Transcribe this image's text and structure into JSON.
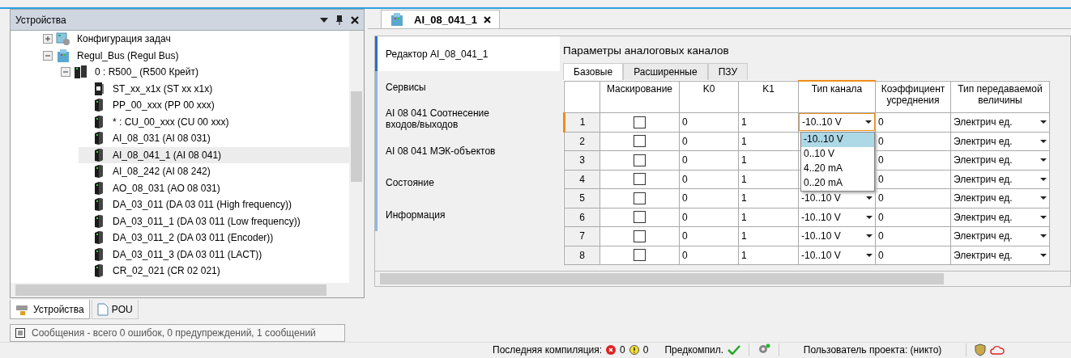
{
  "devices_panel": {
    "title": "Устройства",
    "tree": [
      {
        "label": "Конфигурация задач",
        "kind": "task-config",
        "expanded": false,
        "selected": false
      },
      {
        "label": "Regul_Bus (Regul Bus)",
        "kind": "bus",
        "expanded": true,
        "selected": false,
        "children": [
          {
            "label": "0 : R500_ (R500 Крейт)",
            "kind": "crate",
            "expanded": true,
            "selected": false,
            "children": [
              {
                "label": "ST_xx_x1x (ST xx x1x)",
                "kind": "station",
                "selected": false
              },
              {
                "label": "PP_00_xxx (PP 00 xxx)",
                "kind": "module",
                "selected": false
              },
              {
                "label": "* : CU_00_xxx (CU 00 xxx)",
                "kind": "module",
                "selected": false
              },
              {
                "label": "AI_08_031 (AI 08 031)",
                "kind": "module",
                "selected": false
              },
              {
                "label": "AI_08_041_1 (AI 08 041)",
                "kind": "module",
                "selected": true
              },
              {
                "label": "AI_08_242 (AI 08 242)",
                "kind": "module",
                "selected": false
              },
              {
                "label": "AO_08_031 (AO 08 031)",
                "kind": "module",
                "selected": false
              },
              {
                "label": "DA_03_011 (DA 03 011 (High frequency))",
                "kind": "module",
                "selected": false
              },
              {
                "label": "DA_03_011_1 (DA 03 011 (Low frequency))",
                "kind": "module",
                "selected": false
              },
              {
                "label": "DA_03_011_2 (DA 03 011 (Encoder))",
                "kind": "module",
                "selected": false
              },
              {
                "label": "DA_03_011_3 (DA 03 011 (LACT))",
                "kind": "module",
                "selected": false
              },
              {
                "label": "CR_02_021 (CR 02 021)",
                "kind": "module",
                "selected": false
              }
            ]
          }
        ]
      }
    ],
    "tabs": [
      {
        "label": "Устройства",
        "selected": true
      },
      {
        "label": "POU",
        "selected": false
      }
    ]
  },
  "messages_bar": {
    "text": "Сообщения - всего 0 ошибок, 0 предупреждений, 1 сообщений"
  },
  "editor": {
    "tab": {
      "title": "AI_08_041_1"
    },
    "nav": [
      {
        "label": "Редактор AI_08_041_1",
        "selected": true
      },
      {
        "label": "Сервисы",
        "selected": false
      },
      {
        "label": "AI 08 041 Соотнесение входов/выходов",
        "selected": false
      },
      {
        "label": "AI 08 041 МЭК-объектов",
        "selected": false
      },
      {
        "label": "Состояние",
        "selected": false
      },
      {
        "label": "Информация",
        "selected": false
      }
    ],
    "heading": "Параметры аналоговых каналов",
    "subtabs": [
      {
        "label": "Базовые",
        "selected": true
      },
      {
        "label": "Расширенные",
        "selected": false
      },
      {
        "label": "ПЗУ",
        "selected": false
      }
    ],
    "table": {
      "columns": [
        "Маскирование",
        "K0",
        "K1",
        "Тип канала",
        "Коэффициент усреднения",
        "Тип передаваемой величины"
      ],
      "rows": [
        {
          "number": "1",
          "selected": true,
          "masked": false,
          "k0": "0",
          "k1": "1",
          "channel_type": "-10..10 V",
          "averaging": "0",
          "value_type": "Электрич ед."
        },
        {
          "number": "2",
          "selected": false,
          "masked": false,
          "k0": "0",
          "k1": "1",
          "averaging": "0",
          "value_type": "Электрич ед."
        },
        {
          "number": "3",
          "selected": false,
          "masked": false,
          "k0": "0",
          "k1": "1",
          "averaging": "0",
          "value_type": "Электрич ед."
        },
        {
          "number": "4",
          "selected": false,
          "masked": false,
          "k0": "0",
          "k1": "1",
          "averaging": "0",
          "value_type": "Электрич ед."
        },
        {
          "number": "5",
          "selected": false,
          "masked": false,
          "k0": "0",
          "k1": "1",
          "channel_type": "-10..10 V",
          "averaging": "0",
          "value_type": "Электрич ед."
        },
        {
          "number": "6",
          "selected": false,
          "masked": false,
          "k0": "0",
          "k1": "1",
          "channel_type": "-10..10 V",
          "averaging": "0",
          "value_type": "Электрич ед."
        },
        {
          "number": "7",
          "selected": false,
          "masked": false,
          "k0": "0",
          "k1": "1",
          "channel_type": "-10..10 V",
          "averaging": "0",
          "value_type": "Электрич ед."
        },
        {
          "number": "8",
          "selected": false,
          "masked": false,
          "k0": "0",
          "k1": "1",
          "channel_type": "-10..10 V",
          "averaging": "0",
          "value_type": "Электрич ед."
        }
      ],
      "dropdown": {
        "options": [
          {
            "label": "-10..10 V",
            "selected": true
          },
          {
            "label": "0..10 V",
            "selected": false
          },
          {
            "label": "4..20 mA",
            "selected": false
          },
          {
            "label": "0..20 mA",
            "selected": false
          }
        ]
      }
    }
  },
  "status_bar": {
    "compile_label": "Последняя компиляция:",
    "errors": "0",
    "warnings": "0",
    "precompile_label": "Предкомпил.",
    "user_label": "Пользователь проекта: (никто)"
  }
}
